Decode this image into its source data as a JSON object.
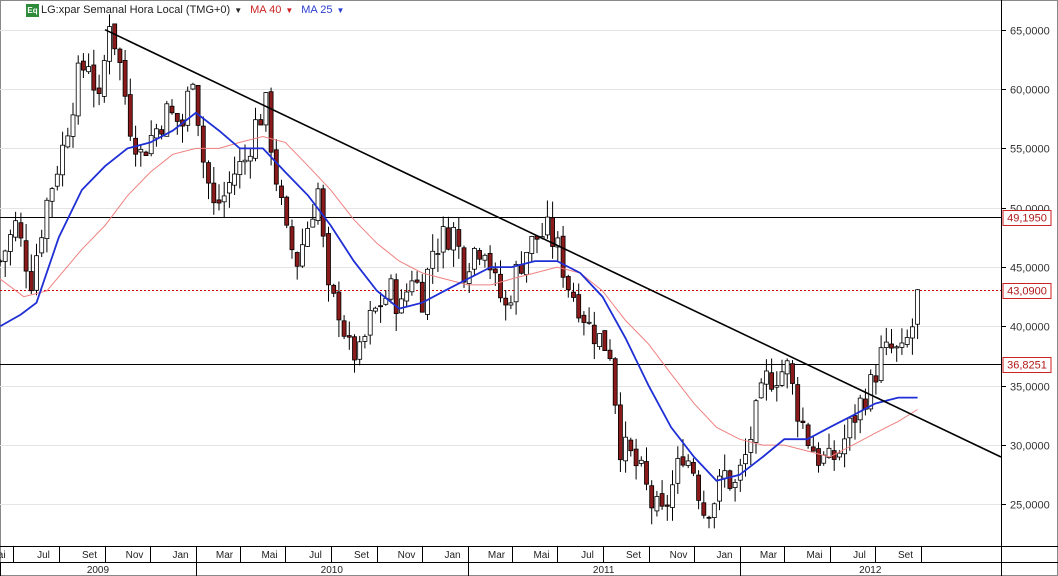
{
  "header": {
    "symbol_badge": "Eq",
    "title": "LG:xpar Semanal Hora Local (TMG+0)",
    "ma40_label": "MA 40",
    "ma25_label": "MA 25",
    "dropdown_glyph": "▼"
  },
  "colors": {
    "up_candle": "#ffffff",
    "down_candle": "#8b1a1a",
    "ma25": "#1f2fd6",
    "ma40": "#f08080",
    "trendline": "#000000",
    "current_price_line": "#cc0000",
    "label_border": "#cc2222"
  },
  "chart_data": {
    "type": "candlestick",
    "title": "LG:xpar Semanal Hora Local (TMG+0)",
    "ylim": [
      21500,
      67500
    ],
    "y_ticks": [
      {
        "value": 25000,
        "label": "25,0000"
      },
      {
        "value": 30000,
        "label": "30,0000"
      },
      {
        "value": 35000,
        "label": "35,0000"
      },
      {
        "value": 40000,
        "label": "40,0000"
      },
      {
        "value": 45000,
        "label": "45,0000"
      },
      {
        "value": 50000,
        "label": "50,0000"
      },
      {
        "value": 55000,
        "label": "55,0000"
      },
      {
        "value": 60000,
        "label": "60,0000"
      },
      {
        "value": 65000,
        "label": "65,0000"
      }
    ],
    "x_range": [
      "2009-04-13",
      "2012-12-17"
    ],
    "month_ticks": [
      {
        "date": "2009-05-01",
        "label": "Mai"
      },
      {
        "date": "2009-07-01",
        "label": "Jul"
      },
      {
        "date": "2009-09-01",
        "label": "Set"
      },
      {
        "date": "2009-11-01",
        "label": "Nov"
      },
      {
        "date": "2010-01-01",
        "label": "Jan"
      },
      {
        "date": "2010-03-01",
        "label": "Mar"
      },
      {
        "date": "2010-05-01",
        "label": "Mai"
      },
      {
        "date": "2010-07-01",
        "label": "Jul"
      },
      {
        "date": "2010-09-01",
        "label": "Set"
      },
      {
        "date": "2010-11-01",
        "label": "Nov"
      },
      {
        "date": "2011-01-01",
        "label": "Jan"
      },
      {
        "date": "2011-03-01",
        "label": "Mar"
      },
      {
        "date": "2011-05-01",
        "label": "Mai"
      },
      {
        "date": "2011-07-01",
        "label": "Jul"
      },
      {
        "date": "2011-09-01",
        "label": "Set"
      },
      {
        "date": "2011-11-01",
        "label": "Nov"
      },
      {
        "date": "2012-01-01",
        "label": "Jan"
      },
      {
        "date": "2012-03-01",
        "label": "Mar"
      },
      {
        "date": "2012-05-01",
        "label": "Mai"
      },
      {
        "date": "2012-07-01",
        "label": "Jul"
      },
      {
        "date": "2012-09-01",
        "label": "Set"
      }
    ],
    "year_ticks": [
      {
        "date": "2009-01-01",
        "label": "2009"
      },
      {
        "date": "2010-01-01",
        "label": "2010"
      },
      {
        "date": "2011-01-01",
        "label": "2011"
      },
      {
        "date": "2012-01-01",
        "label": "2012"
      }
    ],
    "closes": [
      [
        "2009-04-13",
        45500
      ],
      [
        "2009-05-04",
        48500
      ],
      [
        "2009-05-25",
        44000
      ],
      [
        "2009-06-15",
        50500
      ],
      [
        "2009-07-06",
        55000
      ],
      [
        "2009-07-27",
        61000
      ],
      [
        "2009-08-10",
        62500
      ],
      [
        "2009-08-24",
        58500
      ],
      [
        "2009-09-07",
        66000
      ],
      [
        "2009-09-21",
        62000
      ],
      [
        "2009-10-05",
        57000
      ],
      [
        "2009-10-19",
        54500
      ],
      [
        "2009-11-02",
        56000
      ],
      [
        "2009-11-23",
        58000
      ],
      [
        "2009-12-14",
        57000
      ],
      [
        "2009-12-28",
        61500
      ],
      [
        "2010-01-11",
        54000
      ],
      [
        "2010-01-25",
        50000
      ],
      [
        "2010-02-08",
        51000
      ],
      [
        "2010-02-22",
        53000
      ],
      [
        "2010-03-08",
        54000
      ],
      [
        "2010-03-22",
        57000
      ],
      [
        "2010-04-05",
        58500
      ],
      [
        "2010-04-19",
        52500
      ],
      [
        "2010-05-03",
        47500
      ],
      [
        "2010-05-17",
        45500
      ],
      [
        "2010-05-31",
        48500
      ],
      [
        "2010-06-14",
        51500
      ],
      [
        "2010-06-28",
        42500
      ],
      [
        "2010-07-12",
        41500
      ],
      [
        "2010-07-26",
        38000
      ],
      [
        "2010-08-09",
        37500
      ],
      [
        "2010-08-23",
        40500
      ],
      [
        "2010-09-06",
        42000
      ],
      [
        "2010-09-20",
        43000
      ],
      [
        "2010-10-04",
        41500
      ],
      [
        "2010-10-18",
        44500
      ],
      [
        "2010-11-01",
        42500
      ],
      [
        "2010-11-15",
        46500
      ],
      [
        "2010-11-29",
        47500
      ],
      [
        "2010-12-13",
        48000
      ],
      [
        "2010-12-27",
        45000
      ],
      [
        "2011-01-10",
        46500
      ],
      [
        "2011-01-24",
        47000
      ],
      [
        "2011-02-07",
        43500
      ],
      [
        "2011-02-21",
        41500
      ],
      [
        "2011-03-07",
        44500
      ],
      [
        "2011-03-21",
        46500
      ],
      [
        "2011-04-04",
        47500
      ],
      [
        "2011-04-18",
        48000
      ],
      [
        "2011-05-02",
        46500
      ],
      [
        "2011-05-16",
        43500
      ],
      [
        "2011-05-30",
        42000
      ],
      [
        "2011-06-13",
        40000
      ],
      [
        "2011-06-27",
        39000
      ],
      [
        "2011-07-11",
        38000
      ],
      [
        "2011-07-25",
        30000
      ],
      [
        "2011-08-08",
        29000
      ],
      [
        "2011-08-22",
        27500
      ],
      [
        "2011-09-05",
        25000
      ],
      [
        "2011-09-19",
        24000
      ],
      [
        "2011-10-03",
        26500
      ],
      [
        "2011-10-17",
        29500
      ],
      [
        "2011-10-31",
        28000
      ],
      [
        "2011-11-14",
        24500
      ],
      [
        "2011-11-28",
        25500
      ],
      [
        "2011-12-12",
        27500
      ],
      [
        "2011-12-26",
        26500
      ],
      [
        "2012-01-09",
        29000
      ],
      [
        "2012-01-23",
        32500
      ],
      [
        "2012-02-06",
        35500
      ],
      [
        "2012-02-20",
        36000
      ],
      [
        "2012-03-05",
        36500
      ],
      [
        "2012-03-19",
        33000
      ],
      [
        "2012-04-02",
        30500
      ],
      [
        "2012-04-16",
        29000
      ],
      [
        "2012-04-30",
        28500
      ],
      [
        "2012-05-14",
        29500
      ],
      [
        "2012-05-28",
        31500
      ],
      [
        "2012-06-11",
        33500
      ],
      [
        "2012-06-25",
        35000
      ],
      [
        "2012-07-09",
        37500
      ],
      [
        "2012-07-23",
        38000
      ],
      [
        "2012-08-06",
        37500
      ],
      [
        "2012-08-20",
        40000
      ],
      [
        "2012-08-27",
        43090
      ]
    ],
    "ma25_line": [
      [
        "2009-04-13",
        40000
      ],
      [
        "2009-05-11",
        41000
      ],
      [
        "2009-06-01",
        42000
      ],
      [
        "2009-07-01",
        47500
      ],
      [
        "2009-08-01",
        51500
      ],
      [
        "2009-09-01",
        53500
      ],
      [
        "2009-10-01",
        55000
      ],
      [
        "2009-11-01",
        55500
      ],
      [
        "2009-12-01",
        56500
      ],
      [
        "2010-01-01",
        58000
      ],
      [
        "2010-02-01",
        56500
      ],
      [
        "2010-03-01",
        55000
      ],
      [
        "2010-04-01",
        55000
      ],
      [
        "2010-05-01",
        53000
      ],
      [
        "2010-06-01",
        51000
      ],
      [
        "2010-07-01",
        48500
      ],
      [
        "2010-08-01",
        45500
      ],
      [
        "2010-09-01",
        43000
      ],
      [
        "2010-10-01",
        41500
      ],
      [
        "2010-11-01",
        42000
      ],
      [
        "2010-12-01",
        43000
      ],
      [
        "2011-01-01",
        44000
      ],
      [
        "2011-02-01",
        45000
      ],
      [
        "2011-03-01",
        45000
      ],
      [
        "2011-04-01",
        45500
      ],
      [
        "2011-05-01",
        45500
      ],
      [
        "2011-06-01",
        44500
      ],
      [
        "2011-07-01",
        42500
      ],
      [
        "2011-08-01",
        39000
      ],
      [
        "2011-09-01",
        35000
      ],
      [
        "2011-10-01",
        31500
      ],
      [
        "2011-11-01",
        29000
      ],
      [
        "2011-12-01",
        27000
      ],
      [
        "2012-01-01",
        27500
      ],
      [
        "2012-02-01",
        29000
      ],
      [
        "2012-03-01",
        30500
      ],
      [
        "2012-04-01",
        30500
      ],
      [
        "2012-05-01",
        31500
      ],
      [
        "2012-06-01",
        32500
      ],
      [
        "2012-07-01",
        33500
      ],
      [
        "2012-08-01",
        34000
      ],
      [
        "2012-08-27",
        34000
      ]
    ],
    "ma40_line": [
      [
        "2009-04-13",
        44000
      ],
      [
        "2009-05-15",
        42500
      ],
      [
        "2009-06-15",
        43000
      ],
      [
        "2009-08-01",
        46500
      ],
      [
        "2009-09-01",
        48500
      ],
      [
        "2009-10-01",
        51000
      ],
      [
        "2009-11-01",
        53000
      ],
      [
        "2009-12-01",
        54500
      ],
      [
        "2010-01-01",
        55000
      ],
      [
        "2010-02-01",
        55000
      ],
      [
        "2010-03-01",
        55500
      ],
      [
        "2010-04-01",
        56000
      ],
      [
        "2010-05-01",
        55500
      ],
      [
        "2010-06-01",
        53500
      ],
      [
        "2010-07-01",
        51500
      ],
      [
        "2010-08-01",
        49000
      ],
      [
        "2010-09-01",
        47000
      ],
      [
        "2010-10-01",
        45500
      ],
      [
        "2010-11-01",
        44500
      ],
      [
        "2010-12-01",
        44000
      ],
      [
        "2011-01-01",
        43500
      ],
      [
        "2011-02-01",
        43500
      ],
      [
        "2011-03-01",
        44000
      ],
      [
        "2011-04-01",
        44500
      ],
      [
        "2011-05-01",
        45000
      ],
      [
        "2011-06-01",
        44500
      ],
      [
        "2011-07-01",
        43000
      ],
      [
        "2011-08-01",
        40500
      ],
      [
        "2011-09-01",
        38500
      ],
      [
        "2011-10-01",
        36000
      ],
      [
        "2011-11-01",
        33500
      ],
      [
        "2011-12-01",
        31500
      ],
      [
        "2012-01-01",
        30500
      ],
      [
        "2012-02-01",
        30000
      ],
      [
        "2012-03-01",
        30000
      ],
      [
        "2012-04-01",
        29500
      ],
      [
        "2012-05-01",
        29000
      ],
      [
        "2012-06-01",
        30000
      ],
      [
        "2012-07-01",
        31000
      ],
      [
        "2012-08-01",
        32000
      ],
      [
        "2012-08-27",
        33000
      ]
    ],
    "trendline": {
      "start": [
        "2009-09-01",
        65000
      ],
      "end": [
        "2012-12-17",
        29000
      ]
    },
    "horizontal_lines": [
      {
        "value": 49195,
        "label": "49,1950",
        "style": "solid"
      },
      {
        "value": 43090,
        "label": "43,0900",
        "style": "dotted"
      },
      {
        "value": 36825.1,
        "label": "36,8251",
        "style": "solid"
      }
    ],
    "grid": true,
    "legend": "top-left"
  }
}
